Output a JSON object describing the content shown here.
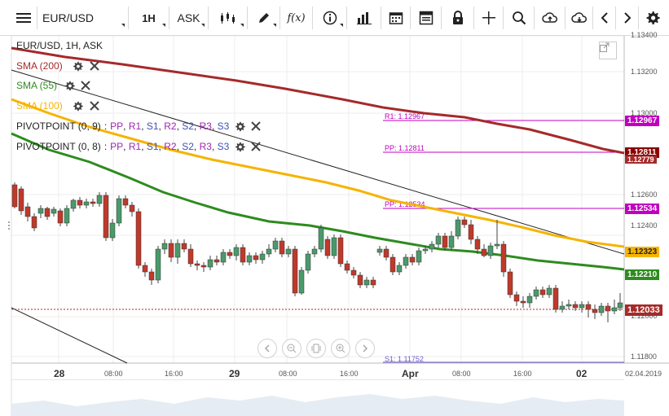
{
  "toolbar": {
    "symbol": "EUR/USD",
    "timeframe": "1H",
    "price_type": "ASK",
    "fx_label": "f(x)"
  },
  "legend": {
    "title": "EUR/USD, 1H, ASK",
    "sma200": "SMA (200)",
    "sma55": "SMA (55)",
    "sma100": "SMA (100)",
    "pivot1_name": "PIVOTPOINT (0, 9)",
    "pivot2_name": "PIVOTPOINT (0, 8)",
    "pivot_levels": [
      {
        "text": "PP",
        "color": "#9c27b0"
      },
      {
        "text": "R1",
        "color": "#9c27b0"
      },
      {
        "text": "S1",
        "color": "#3f51b5"
      },
      {
        "text": "R2",
        "color": "#9c27b0"
      },
      {
        "text": "S2",
        "color": "#3f51b5"
      },
      {
        "text": "R3",
        "color": "#9c27b0"
      },
      {
        "text": "S3",
        "color": "#3f51b5"
      }
    ],
    "colors": {
      "sma200": "#a52a2a",
      "sma55": "#2e8b1f",
      "sma100": "#f5b400",
      "text": "#222222"
    }
  },
  "pivot_labels": {
    "r1": "R1: 1.12967",
    "pp1": "PP: 1.12811",
    "pp2": "PP: 1.12534",
    "s1": "S1: 1.11752",
    "current": "1.12033"
  },
  "price_axis": {
    "labels": [
      "1.13400",
      "1.13200",
      "1.13000",
      "1.12600",
      "1.12400",
      "1.12000",
      "1.11800"
    ],
    "tags": [
      {
        "value": "1.12967",
        "bg": "#c000c0",
        "fg": "#ffffff"
      },
      {
        "value": "1.12811",
        "bg": "#8b0000",
        "fg": "#ffffff"
      },
      {
        "value": "1.12779",
        "bg": "#a52a2a",
        "fg": "#ffffff"
      },
      {
        "value": "1.12534",
        "bg": "#c000c0",
        "fg": "#ffffff"
      },
      {
        "value": "1.12323",
        "bg": "#f5b400",
        "fg": "#222222"
      },
      {
        "value": "1.12210",
        "bg": "#2e8b1f",
        "fg": "#ffffff"
      },
      {
        "value": "1.12033",
        "bg": "#a52a2a",
        "fg": "#ffffff"
      }
    ]
  },
  "time_axis": {
    "labels": [
      "28",
      "08:00",
      "16:00",
      "29",
      "08:00",
      "16:00",
      "Apr",
      "08:00",
      "16:00",
      "02",
      "02.04.2019"
    ]
  },
  "chart_data": {
    "type": "candlestick",
    "title": "EUR/USD, 1H, ASK",
    "ylim": [
      1.1176,
      1.1342
    ],
    "series": [
      {
        "name": "SMA (200)",
        "color": "#a52a2a"
      },
      {
        "name": "SMA (55)",
        "color": "#2e8b1f"
      },
      {
        "name": "SMA (100)",
        "color": "#f5b400"
      }
    ],
    "pivot_levels": {
      "R1": 1.12967,
      "PP_0_9": 1.12811,
      "PP_0_8": 1.12534,
      "S1": 1.11752
    },
    "last_price": 1.12033,
    "candles_note": "hourly candles from Mar 28 to Apr 2, 2019"
  }
}
